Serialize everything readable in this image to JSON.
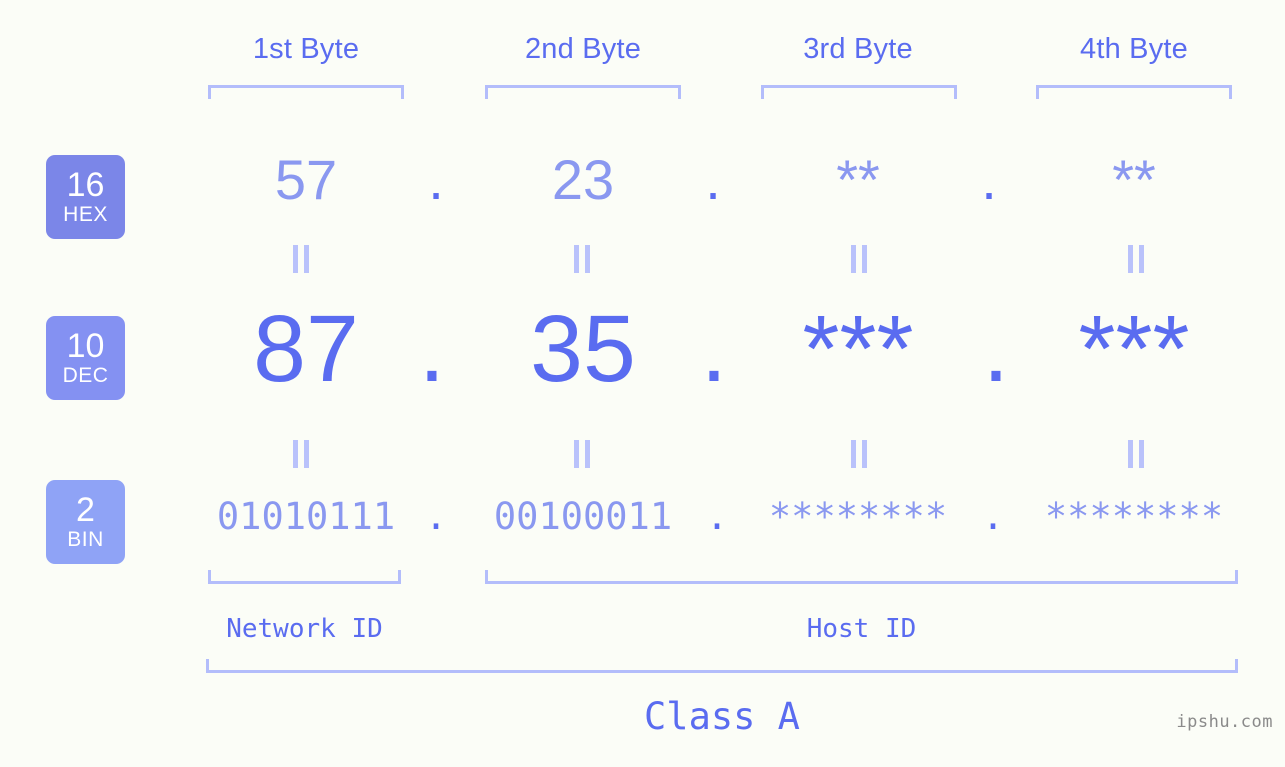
{
  "meta": {
    "watermark": "ipshu.com"
  },
  "columns": [
    {
      "header": "1st Byte",
      "hex": "57",
      "dec": "87",
      "bin": "01010111"
    },
    {
      "header": "2nd Byte",
      "hex": "23",
      "dec": "35",
      "bin": "00100011"
    },
    {
      "header": "3rd Byte",
      "hex": "**",
      "dec": "***",
      "bin": "********"
    },
    {
      "header": "4th Byte",
      "hex": "**",
      "dec": "***",
      "bin": "********"
    }
  ],
  "separators": {
    "hex_dot": ".",
    "dec_dot": ".",
    "bin_dot": "."
  },
  "radix_badges": [
    {
      "radix": "16",
      "name": "HEX",
      "color": "#7b86e8"
    },
    {
      "radix": "10",
      "name": "DEC",
      "color": "#8491f2"
    },
    {
      "radix": "2",
      "name": "BIN",
      "color": "#8fa3f6"
    }
  ],
  "equals_symbol": "=",
  "segments": {
    "network_id": "Network ID",
    "host_id": "Host ID",
    "class": "Class A"
  },
  "colors": {
    "background": "#fbfdf7",
    "accent_strong": "#5a6cf0",
    "accent_mid": "#8a98f0",
    "accent_light": "#b3bdfb",
    "watermark": "#8a8a8a"
  }
}
